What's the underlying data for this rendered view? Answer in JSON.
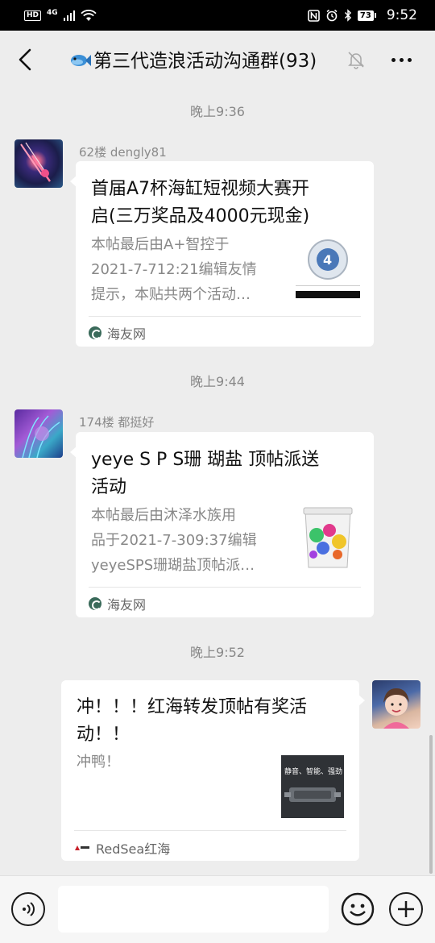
{
  "status_bar": {
    "left_badge": "HD",
    "network": "4G",
    "battery": "73",
    "time": "9:52"
  },
  "header": {
    "title": "第三代造浪活动沟通群(93)",
    "back_icon": "chevron-left-icon",
    "mute_icon": "bell-off-icon",
    "more_icon": "more-dots-icon"
  },
  "messages": [
    {
      "time": "晚上9:36",
      "sender": "62楼 dengly81",
      "title_lines": [
        "首届A7杯海缸短视频大赛开",
        "启(三万奖品及4000元现金)"
      ],
      "desc_lines": [
        "本帖最后由A+智控于",
        "2021-7-712:21编辑友情",
        "提示，本贴共两个活动…"
      ],
      "source": "海友网",
      "side": "left"
    },
    {
      "time": "晚上9:44",
      "sender": "174楼  都挺好",
      "title_lines": [
        "yeye S P S珊 瑚盐 顶帖派送",
        "活动"
      ],
      "desc_lines": [
        "本帖最后由沐泽水族用",
        "品于2021-7-309:37编辑",
        "yeyeSPS珊瑚盐顶帖派…"
      ],
      "source": "海友网",
      "side": "left"
    },
    {
      "time": "晚上9:52",
      "title_lines": [
        "冲！！！红海转发顶帖有奖活",
        "动！！"
      ],
      "desc_lines": [
        "冲鸭！"
      ],
      "thumb_text": "静音、智能、强劲",
      "source": "RedSea红海",
      "side": "right"
    }
  ],
  "input_bar": {
    "voice_icon": "voice-icon",
    "emoji_icon": "emoji-icon",
    "plus_icon": "plus-icon"
  }
}
